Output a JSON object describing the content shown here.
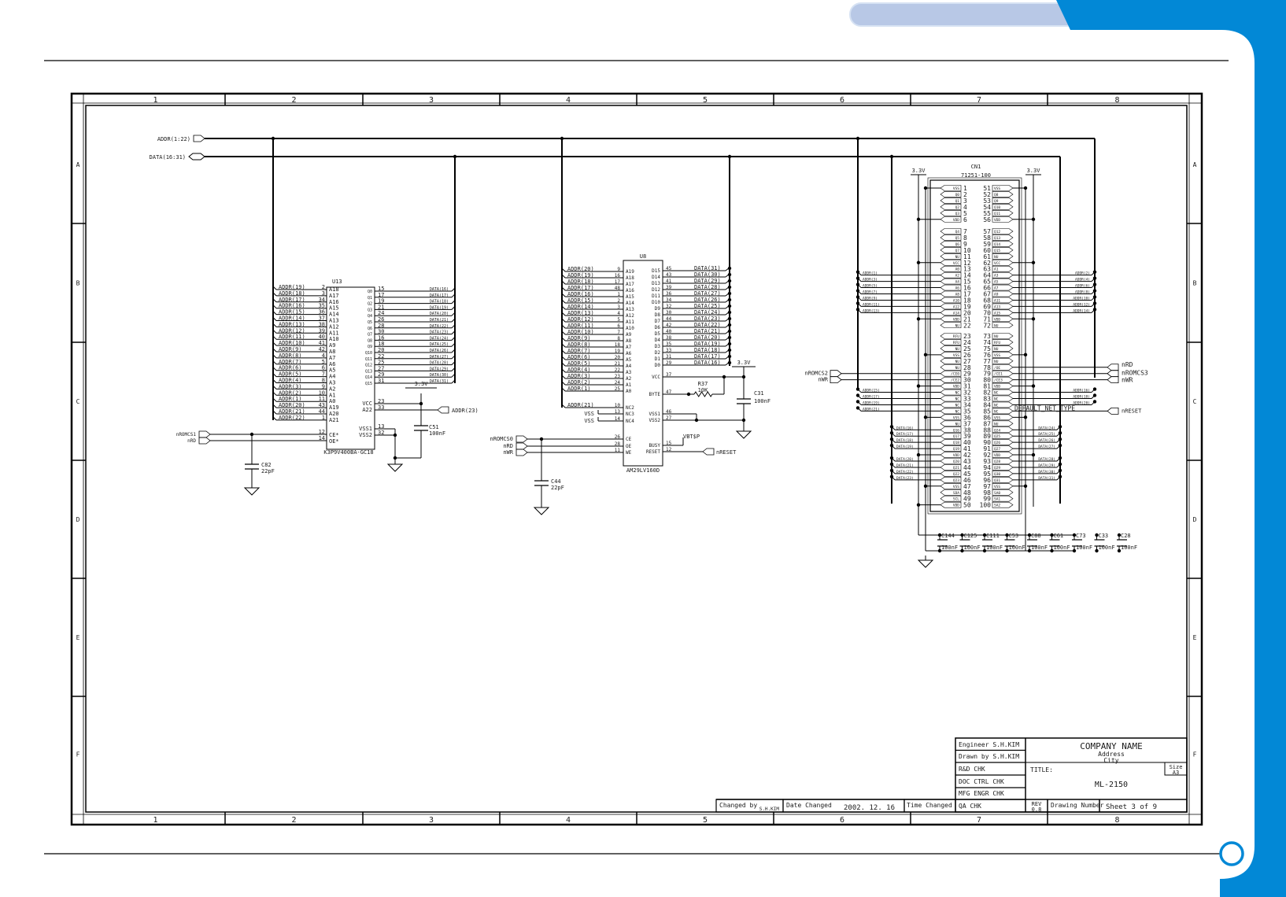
{
  "colors": {
    "brand_blue": "#0288d6",
    "tab_pill": "#b8c8e6"
  },
  "frame": {
    "columns": [
      "1",
      "2",
      "3",
      "4",
      "5",
      "6",
      "7",
      "8"
    ],
    "rows": [
      "A",
      "B",
      "C",
      "D",
      "E",
      "F"
    ]
  },
  "buses": {
    "addr_port": "ADDR(1:22)",
    "data_port": "DATA(16:31)"
  },
  "u13": {
    "ref": "U13",
    "part": "K3P9V400BA-GC18",
    "left": [
      [
        "ADDR(19)",
        "2",
        "A18"
      ],
      [
        "ADDR(18)",
        "3",
        "A17"
      ],
      [
        "ADDR(17)",
        "34",
        "A16"
      ],
      [
        "ADDR(16)",
        "35",
        "A15"
      ],
      [
        "ADDR(15)",
        "36",
        "A14"
      ],
      [
        "ADDR(14)",
        "37",
        "A13"
      ],
      [
        "ADDR(13)",
        "38",
        "A12"
      ],
      [
        "ADDR(12)",
        "39",
        "A11"
      ],
      [
        "ADDR(11)",
        "40",
        "A10"
      ],
      [
        "ADDR(10)",
        "41",
        "A9"
      ],
      [
        "ADDR(9)",
        "42",
        "A8"
      ],
      [
        "ADDR(8)",
        "4",
        "A7"
      ],
      [
        "ADDR(7)",
        "5",
        "A6"
      ],
      [
        "ADDR(6)",
        "6",
        "A5"
      ],
      [
        "ADDR(5)",
        "7",
        "A4"
      ],
      [
        "ADDR(4)",
        "8",
        "A3"
      ],
      [
        "ADDR(3)",
        "9",
        "A2"
      ],
      [
        "ADDR(2)",
        "10",
        "A1"
      ],
      [
        "ADDR(1)",
        "11",
        "A0"
      ],
      [
        "ADDR(20)",
        "43",
        "A19"
      ],
      [
        "ADDR(21)",
        "44",
        "A20"
      ],
      [
        "ADDR(22)",
        "1",
        "A21"
      ]
    ],
    "right": [
      [
        "Q0",
        "15",
        "DATA(16)"
      ],
      [
        "Q1",
        "17",
        "DATA(17)"
      ],
      [
        "Q2",
        "19",
        "DATA(18)"
      ],
      [
        "Q3",
        "21",
        "DATA(19)"
      ],
      [
        "Q4",
        "24",
        "DATA(20)"
      ],
      [
        "Q5",
        "26",
        "DATA(21)"
      ],
      [
        "Q6",
        "28",
        "DATA(22)"
      ],
      [
        "Q7",
        "30",
        "DATA(23)"
      ],
      [
        "Q8",
        "16",
        "DATA(24)"
      ],
      [
        "Q9",
        "18",
        "DATA(25)"
      ],
      [
        "Q10",
        "20",
        "DATA(26)"
      ],
      [
        "Q11",
        "22",
        "DATA(27)"
      ],
      [
        "Q12",
        "25",
        "DATA(28)"
      ],
      [
        "Q13",
        "27",
        "DATA(29)"
      ],
      [
        "Q14",
        "29",
        "DATA(30)"
      ],
      [
        "Q15",
        "31",
        "DATA(31)"
      ]
    ],
    "power": [
      [
        "VCC",
        "23"
      ],
      [
        "A22",
        "33"
      ],
      [
        "VSS1",
        "13"
      ],
      [
        "VSS2",
        "32"
      ]
    ],
    "control": [
      [
        "CE*",
        "12",
        "nROMCS1"
      ],
      [
        "OE*",
        "14",
        "nRD"
      ]
    ],
    "a22_net": "ADDR(23)",
    "supply": "3.3V",
    "c51": {
      "ref": "C51",
      "value": "100nF"
    },
    "c82": {
      "ref": "C82",
      "value": "22pF"
    }
  },
  "u8": {
    "ref": "U8",
    "part": "AM29LV160D",
    "left": [
      [
        "ADDR(20)",
        "9",
        "A19"
      ],
      [
        "ADDR(19)",
        "16",
        "A18"
      ],
      [
        "ADDR(18)",
        "17",
        "A17"
      ],
      [
        "ADDR(17)",
        "48",
        "A16"
      ],
      [
        "ADDR(16)",
        "1",
        "A15"
      ],
      [
        "ADDR(15)",
        "2",
        "A14"
      ],
      [
        "ADDR(14)",
        "3",
        "A13"
      ],
      [
        "ADDR(13)",
        "4",
        "A12"
      ],
      [
        "ADDR(12)",
        "5",
        "A11"
      ],
      [
        "ADDR(11)",
        "6",
        "A10"
      ],
      [
        "ADDR(10)",
        "7",
        "A9"
      ],
      [
        "ADDR(9)",
        "8",
        "A8"
      ],
      [
        "ADDR(8)",
        "18",
        "A7"
      ],
      [
        "ADDR(7)",
        "19",
        "A6"
      ],
      [
        "ADDR(6)",
        "20",
        "A5"
      ],
      [
        "ADDR(5)",
        "21",
        "A4"
      ],
      [
        "ADDR(4)",
        "22",
        "A3"
      ],
      [
        "ADDR(3)",
        "23",
        "A2"
      ],
      [
        "ADDR(2)",
        "24",
        "A1"
      ],
      [
        "ADDR(1)",
        "25",
        "A0"
      ]
    ],
    "nc": [
      [
        "ADDR(21)",
        "10",
        "NC2"
      ],
      [
        "VSS",
        "13",
        "NC3"
      ],
      [
        "VSS",
        "14",
        "NC4"
      ]
    ],
    "control": [
      [
        "nROMCS0",
        "26",
        "CE"
      ],
      [
        "nRD",
        "28",
        "OE"
      ],
      [
        "nWR",
        "11",
        "WE"
      ]
    ],
    "right": [
      [
        "D15",
        "45",
        "DATA(31)"
      ],
      [
        "D14",
        "43",
        "DATA(30)"
      ],
      [
        "D13",
        "41",
        "DATA(29)"
      ],
      [
        "D12",
        "39",
        "DATA(28)"
      ],
      [
        "D11",
        "36",
        "DATA(27)"
      ],
      [
        "D10",
        "34",
        "DATA(26)"
      ],
      [
        "D9",
        "32",
        "DATA(25)"
      ],
      [
        "D8",
        "30",
        "DATA(24)"
      ],
      [
        "D7",
        "44",
        "DATA(23)"
      ],
      [
        "D6",
        "42",
        "DATA(22)"
      ],
      [
        "D5",
        "40",
        "DATA(21)"
      ],
      [
        "D4",
        "38",
        "DATA(20)"
      ],
      [
        "D3",
        "35",
        "DATA(19)"
      ],
      [
        "D2",
        "33",
        "DATA(18)"
      ],
      [
        "D1",
        "31",
        "DATA(17)"
      ],
      [
        "D0",
        "29",
        "DATA(16)"
      ]
    ],
    "power": [
      [
        "VCC",
        "37"
      ],
      [
        "BYTE",
        "47"
      ],
      [
        "VSS1",
        "46"
      ],
      [
        "VSS2",
        "27"
      ],
      [
        "BUSY",
        "15"
      ],
      [
        "RESET",
        "12"
      ]
    ],
    "busy_net": "VBT$P",
    "reset_net": "nRESET",
    "supply": "3.3V",
    "r37": {
      "ref": "R37",
      "value": "10K"
    },
    "c31": {
      "ref": "C31",
      "value": "100nF"
    },
    "c44": {
      "ref": "C44",
      "value": "22pF"
    }
  },
  "cn1": {
    "ref": "CN1",
    "part": "71251-100",
    "supply": "3.3V",
    "left": [
      [
        "1",
        "VSS"
      ],
      [
        "2",
        "Q0"
      ],
      [
        "3",
        "Q1"
      ],
      [
        "4",
        "Q2"
      ],
      [
        "5",
        "Q3"
      ],
      [
        "6",
        "VDD"
      ],
      [
        "7",
        "Q4"
      ],
      [
        "8",
        "Q5"
      ],
      [
        "9",
        "Q6"
      ],
      [
        "10",
        "Q7"
      ],
      [
        "11",
        "NU"
      ],
      [
        "12",
        "VCC"
      ],
      [
        "13",
        "A0"
      ],
      [
        "14",
        "A2"
      ],
      [
        "15",
        "A4"
      ],
      [
        "16",
        "A6"
      ],
      [
        "17",
        "A8"
      ],
      [
        "18",
        "A10"
      ],
      [
        "19",
        "A12"
      ],
      [
        "20",
        "A14"
      ],
      [
        "21",
        "VDD"
      ],
      [
        "22",
        "NU"
      ],
      [
        "23",
        "RFU"
      ],
      [
        "24",
        "RFU"
      ],
      [
        "25",
        "NU"
      ],
      [
        "26",
        "VSS"
      ],
      [
        "27",
        "NU"
      ],
      [
        "28",
        "NU"
      ],
      [
        "29",
        "/CE0"
      ],
      [
        "30",
        "/CE2"
      ],
      [
        "31",
        "VDD"
      ],
      [
        "32",
        "NC"
      ],
      [
        "33",
        "NC"
      ],
      [
        "34",
        "NC"
      ],
      [
        "35",
        "NC"
      ],
      [
        "36",
        "VSS"
      ],
      [
        "37",
        "NU"
      ],
      [
        "38",
        "Q16"
      ],
      [
        "39",
        "Q17"
      ],
      [
        "40",
        "Q18"
      ],
      [
        "41",
        "Q19"
      ],
      [
        "42",
        "VDD"
      ],
      [
        "43",
        "Q20"
      ],
      [
        "44",
        "Q21"
      ],
      [
        "45",
        "Q22"
      ],
      [
        "46",
        "Q23"
      ],
      [
        "47",
        "VSS"
      ],
      [
        "48",
        "SDA"
      ],
      [
        "49",
        "SCL"
      ],
      [
        "50",
        "VDD"
      ]
    ],
    "right": [
      [
        "51",
        "VSS"
      ],
      [
        "52",
        "Q8"
      ],
      [
        "53",
        "Q9"
      ],
      [
        "54",
        "Q10"
      ],
      [
        "55",
        "Q11"
      ],
      [
        "56",
        "VDD"
      ],
      [
        "57",
        "Q12"
      ],
      [
        "58",
        "Q13"
      ],
      [
        "59",
        "Q14"
      ],
      [
        "60",
        "Q15"
      ],
      [
        "61",
        "NU"
      ],
      [
        "62",
        "VCC"
      ],
      [
        "63",
        "A1"
      ],
      [
        "64",
        "A3"
      ],
      [
        "65",
        "A5"
      ],
      [
        "66",
        "A7"
      ],
      [
        "67",
        "A9"
      ],
      [
        "68",
        "A11"
      ],
      [
        "69",
        "A13"
      ],
      [
        "70",
        "A15"
      ],
      [
        "71",
        "VDD"
      ],
      [
        "72",
        "NU"
      ],
      [
        "73",
        "NU"
      ],
      [
        "74",
        "RFU"
      ],
      [
        "75",
        "NU"
      ],
      [
        "76",
        "VSS"
      ],
      [
        "77",
        "NU"
      ],
      [
        "78",
        "/OE"
      ],
      [
        "79",
        "/CE1"
      ],
      [
        "80",
        "/CE3"
      ],
      [
        "81",
        "VDD"
      ],
      [
        "82",
        "NC"
      ],
      [
        "83",
        "NC"
      ],
      [
        "84",
        "NC"
      ],
      [
        "85",
        "NC"
      ],
      [
        "86",
        "VSS"
      ],
      [
        "87",
        "NU"
      ],
      [
        "88",
        "Q24"
      ],
      [
        "89",
        "Q25"
      ],
      [
        "90",
        "Q26"
      ],
      [
        "91",
        "Q27"
      ],
      [
        "92",
        "VDD"
      ],
      [
        "93",
        "Q28"
      ],
      [
        "94",
        "Q29"
      ],
      [
        "95",
        "Q30"
      ],
      [
        "96",
        "Q31"
      ],
      [
        "97",
        "VSS"
      ],
      [
        "98",
        "SA0"
      ],
      [
        "99",
        "SA1"
      ],
      [
        "100",
        "SA2"
      ]
    ],
    "left_nets": [
      [
        "14",
        "ADDR(1)"
      ],
      [
        "15",
        "ADDR(3)"
      ],
      [
        "16",
        "ADDR(5)"
      ],
      [
        "17",
        "ADDR(7)"
      ],
      [
        "18",
        "ADDR(9)"
      ],
      [
        "19",
        "ADDR(11)"
      ],
      [
        "20",
        "ADDR(13)"
      ],
      [
        "32",
        "ADDR(15)"
      ],
      [
        "33",
        "ADDR(17)"
      ],
      [
        "34",
        "ADDR(19)"
      ],
      [
        "35",
        "ADDR(21)"
      ],
      [
        "38",
        "DATA(16)"
      ],
      [
        "39",
        "DATA(17)"
      ],
      [
        "40",
        "DATA(18)"
      ],
      [
        "41",
        "DATA(19)"
      ],
      [
        "43",
        "DATA(20)"
      ],
      [
        "44",
        "DATA(21)"
      ],
      [
        "45",
        "DATA(22)"
      ],
      [
        "46",
        "DATA(23)"
      ]
    ],
    "right_nets": [
      [
        "64",
        "ADDR(2)"
      ],
      [
        "65",
        "ADDR(4)"
      ],
      [
        "66",
        "ADDR(6)"
      ],
      [
        "67",
        "ADDR(8)"
      ],
      [
        "68",
        "ADDR(10)"
      ],
      [
        "69",
        "ADDR(12)"
      ],
      [
        "70",
        "ADDR(14)"
      ],
      [
        "82",
        "ADDR(16)"
      ],
      [
        "83",
        "ADDR(18)"
      ],
      [
        "84",
        "ADDR(20)"
      ],
      [
        "88",
        "DATA(24)"
      ],
      [
        "89",
        "DATA(25)"
      ],
      [
        "90",
        "DATA(26)"
      ],
      [
        "91",
        "DATA(27)"
      ],
      [
        "93",
        "DATA(28)"
      ],
      [
        "94",
        "DATA(29)"
      ],
      [
        "95",
        "DATA(30)"
      ],
      [
        "96",
        "DATA(31)"
      ]
    ],
    "left_ports": [
      [
        "29",
        "nROMCS2"
      ],
      [
        "30",
        "nWR"
      ]
    ],
    "right_ports": [
      [
        "78",
        "nRD"
      ],
      [
        "79",
        "nROMCS3"
      ],
      [
        "80",
        "nWR"
      ],
      [
        "85",
        "nRESET"
      ]
    ],
    "default_net_type": "DEFAULT_NET_TYPE",
    "caps": [
      [
        "C144",
        "100nF"
      ],
      [
        "C125",
        "100nF"
      ],
      [
        "C111",
        "100nF"
      ],
      [
        "C53",
        "100nF"
      ],
      [
        "C88",
        "100nF"
      ],
      [
        "C61",
        "100nF"
      ],
      [
        "C73",
        "100nF"
      ],
      [
        "C33",
        "100nF"
      ],
      [
        "C28",
        "100nF"
      ]
    ]
  },
  "title_block": {
    "engineer": "Engineer S.H.KIM",
    "drawn_by": "Drawn by S.H.KIM",
    "rd_chk": "R&D CHK",
    "doc_ctrl_chk": "DOC CTRL CHK",
    "mfg_engr_chk": "MFG ENGR CHK",
    "qa_chk": "QA CHK",
    "company": "COMPANY NAME",
    "address": "Address",
    "city": "City",
    "title_label": "TITLE:",
    "title": "ML-2150",
    "size_label": "Size",
    "size": "A3",
    "changed_by_label": "Changed by",
    "changed_by": "S.H.KIM",
    "date_changed_label": "Date Changed",
    "date_changed": "2002. 12. 16",
    "time_changed_label": "Time Changed",
    "rev_label": "REV",
    "rev": "0.8",
    "drawing_number_label": "Drawing Number",
    "sheet": "Sheet 3 of 9"
  }
}
